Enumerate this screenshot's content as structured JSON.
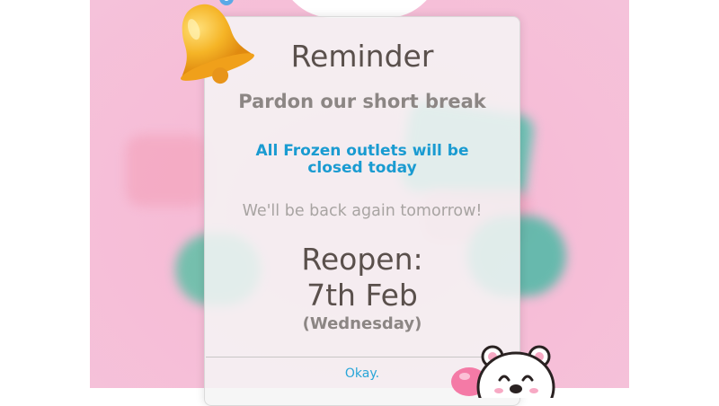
{
  "popup": {
    "title": "Reminder",
    "subtitle": "Pardon our short break",
    "notice_line1": "All Frozen outlets will be",
    "notice_line2": "closed today",
    "back_message": "We'll be back again tomorrow!",
    "reopen_label": "Reopen:",
    "reopen_date": "7th Feb",
    "reopen_weekday": "(Wednesday)",
    "okay_button": "Okay."
  },
  "colors": {
    "background_pink": "#f6bcd6",
    "notice_blue": "#1a9bd1",
    "button_blue": "#2aa6d8",
    "bell_yellow": "#f4b526"
  },
  "icons": [
    "bell-icon",
    "bear-mascot"
  ]
}
